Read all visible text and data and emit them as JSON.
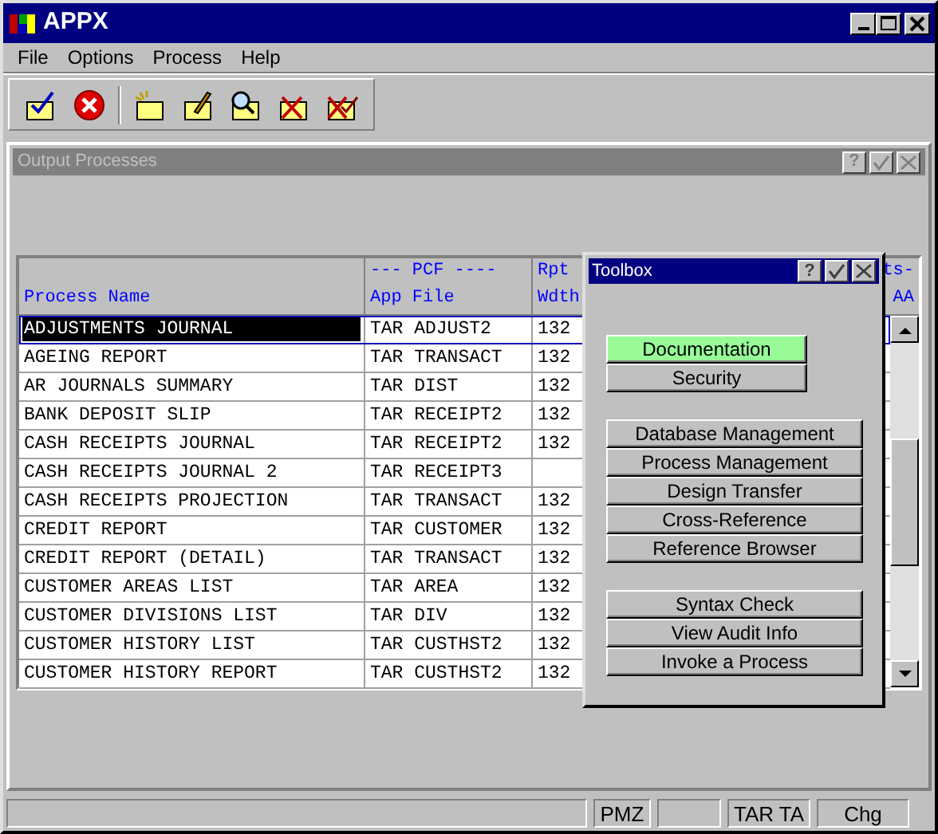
{
  "window": {
    "title": "APPX"
  },
  "menu": [
    "File",
    "Options",
    "Process",
    "Help"
  ],
  "toolbar": [
    {
      "kind": "check"
    },
    {
      "kind": "cancel"
    },
    {
      "kind": "separator"
    },
    {
      "kind": "new"
    },
    {
      "kind": "edit"
    },
    {
      "kind": "search"
    },
    {
      "kind": "delete"
    },
    {
      "kind": "delete-check"
    }
  ],
  "child_window": {
    "title": "Output Processes",
    "help": "?",
    "active": false
  },
  "table": {
    "columns": [
      {
        "lines": [
          "Process Name"
        ]
      },
      {
        "lines": [
          "--- PCF ----",
          "App File"
        ]
      },
      {
        "lines": [
          "Rpt",
          "Wdth"
        ]
      },
      {
        "lines": [
          "ts-",
          "AA"
        ]
      }
    ],
    "rows": [
      {
        "process_name": "ADJUSTMENTS JOURNAL",
        "app": "TAR",
        "file": "ADJUST2",
        "rpt_wdth": "132",
        "selected": true
      },
      {
        "process_name": "AGEING REPORT",
        "app": "TAR",
        "file": "TRANSACT",
        "rpt_wdth": "132",
        "selected": false
      },
      {
        "process_name": "AR JOURNALS SUMMARY",
        "app": "TAR",
        "file": "DIST",
        "rpt_wdth": "132",
        "selected": false
      },
      {
        "process_name": "BANK DEPOSIT SLIP",
        "app": "TAR",
        "file": "RECEIPT2",
        "rpt_wdth": "132",
        "selected": false
      },
      {
        "process_name": "CASH RECEIPTS JOURNAL",
        "app": "TAR",
        "file": "RECEIPT2",
        "rpt_wdth": "132",
        "selected": false
      },
      {
        "process_name": "CASH RECEIPTS JOURNAL 2",
        "app": "TAR",
        "file": "RECEIPT3",
        "selected": false
      },
      {
        "process_name": "CASH RECEIPTS PROJECTION",
        "app": "TAR",
        "file": "TRANSACT",
        "rpt_wdth": "132",
        "selected": false
      },
      {
        "process_name": "CREDIT REPORT",
        "app": "TAR",
        "file": "CUSTOMER",
        "rpt_wdth": "132",
        "selected": false
      },
      {
        "process_name": "CREDIT REPORT (DETAIL)",
        "app": "TAR",
        "file": "TRANSACT",
        "rpt_wdth": "132",
        "selected": false
      },
      {
        "process_name": "CUSTOMER AREAS LIST",
        "app": "TAR",
        "file": "AREA",
        "rpt_wdth": "132",
        "selected": false
      },
      {
        "process_name": "CUSTOMER DIVISIONS LIST",
        "app": "TAR",
        "file": "DIV",
        "rpt_wdth": "132",
        "selected": false
      },
      {
        "process_name": "CUSTOMER HISTORY LIST",
        "app": "TAR",
        "file": "CUSTHST2",
        "rpt_wdth": "132",
        "selected": false
      },
      {
        "process_name": "CUSTOMER HISTORY REPORT",
        "app": "TAR",
        "file": "CUSTHST2",
        "rpt_wdth": "132",
        "selected": false
      }
    ]
  },
  "toolbox": {
    "title": "Toolbox",
    "help": "?",
    "groups": [
      [
        {
          "label": "Documentation",
          "highlighted": true
        },
        {
          "label": "Security",
          "highlighted": false
        }
      ],
      [
        {
          "label": "Database Management",
          "highlighted": false
        },
        {
          "label": "Process Management",
          "highlighted": false
        },
        {
          "label": "Design Transfer",
          "highlighted": false
        },
        {
          "label": "Cross-Reference",
          "highlighted": false
        },
        {
          "label": "Reference Browser",
          "highlighted": false
        }
      ],
      [
        {
          "label": "Syntax Check",
          "highlighted": false
        },
        {
          "label": "View Audit Info",
          "highlighted": false
        },
        {
          "label": "Invoke a Process",
          "highlighted": false
        }
      ]
    ]
  },
  "status_bar": [
    {
      "kind": "blank"
    },
    {
      "kind": "text",
      "text": "PMZ"
    },
    {
      "kind": "blank"
    },
    {
      "kind": "text",
      "text": "TAR TA"
    },
    {
      "kind": "text",
      "text": "Chg"
    }
  ]
}
